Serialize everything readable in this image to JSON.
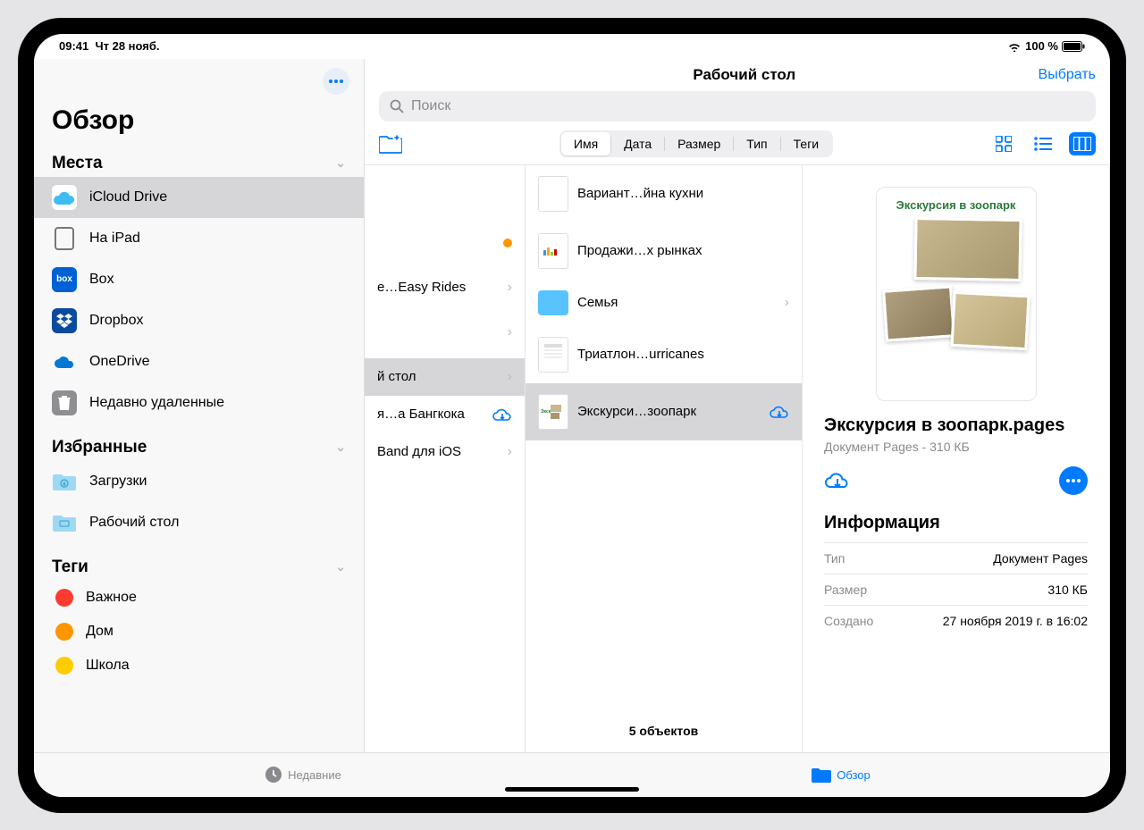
{
  "status": {
    "time": "09:41",
    "date": "Чт 28 нояб.",
    "battery": "100 %"
  },
  "sidebar": {
    "title": "Обзор",
    "sections": {
      "locations_label": "Места",
      "locations": [
        {
          "label": "iCloud Drive"
        },
        {
          "label": "На iPad"
        },
        {
          "label": "Box"
        },
        {
          "label": "Dropbox"
        },
        {
          "label": "OneDrive"
        },
        {
          "label": "Недавно удаленные"
        }
      ],
      "favorites_label": "Избранные",
      "favorites": [
        {
          "label": "Загрузки"
        },
        {
          "label": "Рабочий стол"
        }
      ],
      "tags_label": "Теги",
      "tags": [
        {
          "label": "Важное",
          "color": "#ff3b30"
        },
        {
          "label": "Дом",
          "color": "#ff9500"
        },
        {
          "label": "Школа",
          "color": "#ffcc00"
        }
      ]
    }
  },
  "header": {
    "title": "Рабочий стол",
    "select": "Выбрать",
    "search_placeholder": "Поиск",
    "sort": {
      "name": "Имя",
      "date": "Дата",
      "size": "Размер",
      "type": "Тип",
      "tags": "Теги"
    }
  },
  "col1": [
    {
      "label": "",
      "kind": "doc"
    },
    {
      "label": "",
      "kind": "orange-dot"
    },
    {
      "label": "e…Easy Rides",
      "kind": "folder-chev"
    },
    {
      "label": "",
      "kind": "folder-chev"
    },
    {
      "label": "й стол",
      "kind": "folder-chev-sel"
    },
    {
      "label": "я…а Бангкока",
      "kind": "cloud"
    },
    {
      "label": "Band для iOS",
      "kind": "folder-chev"
    }
  ],
  "col2": {
    "items": [
      {
        "label": "Вариант…йна кухни",
        "thumb": "doc"
      },
      {
        "label": "Продажи…х рынках",
        "thumb": "chart"
      },
      {
        "label": "Семья",
        "thumb": "folder",
        "chev": true
      },
      {
        "label": "Триатлон…urricanes",
        "thumb": "table"
      },
      {
        "label": "Экскурси…зоопарк",
        "thumb": "zoo",
        "cloud": true,
        "selected": true
      }
    ],
    "count": "5 объектов"
  },
  "preview": {
    "doc_title": "Экскурсия в зоопарк",
    "filename": "Экскурсия в зоопарк.pages",
    "meta": "Документ Pages - 310 КБ",
    "info_label": "Информация",
    "rows": [
      {
        "k": "Тип",
        "v": "Документ Pages"
      },
      {
        "k": "Размер",
        "v": "310 КБ"
      },
      {
        "k": "Создано",
        "v": "27 ноября 2019 г. в 16:02"
      }
    ]
  },
  "tabs": {
    "recent": "Недавние",
    "browse": "Обзор"
  }
}
